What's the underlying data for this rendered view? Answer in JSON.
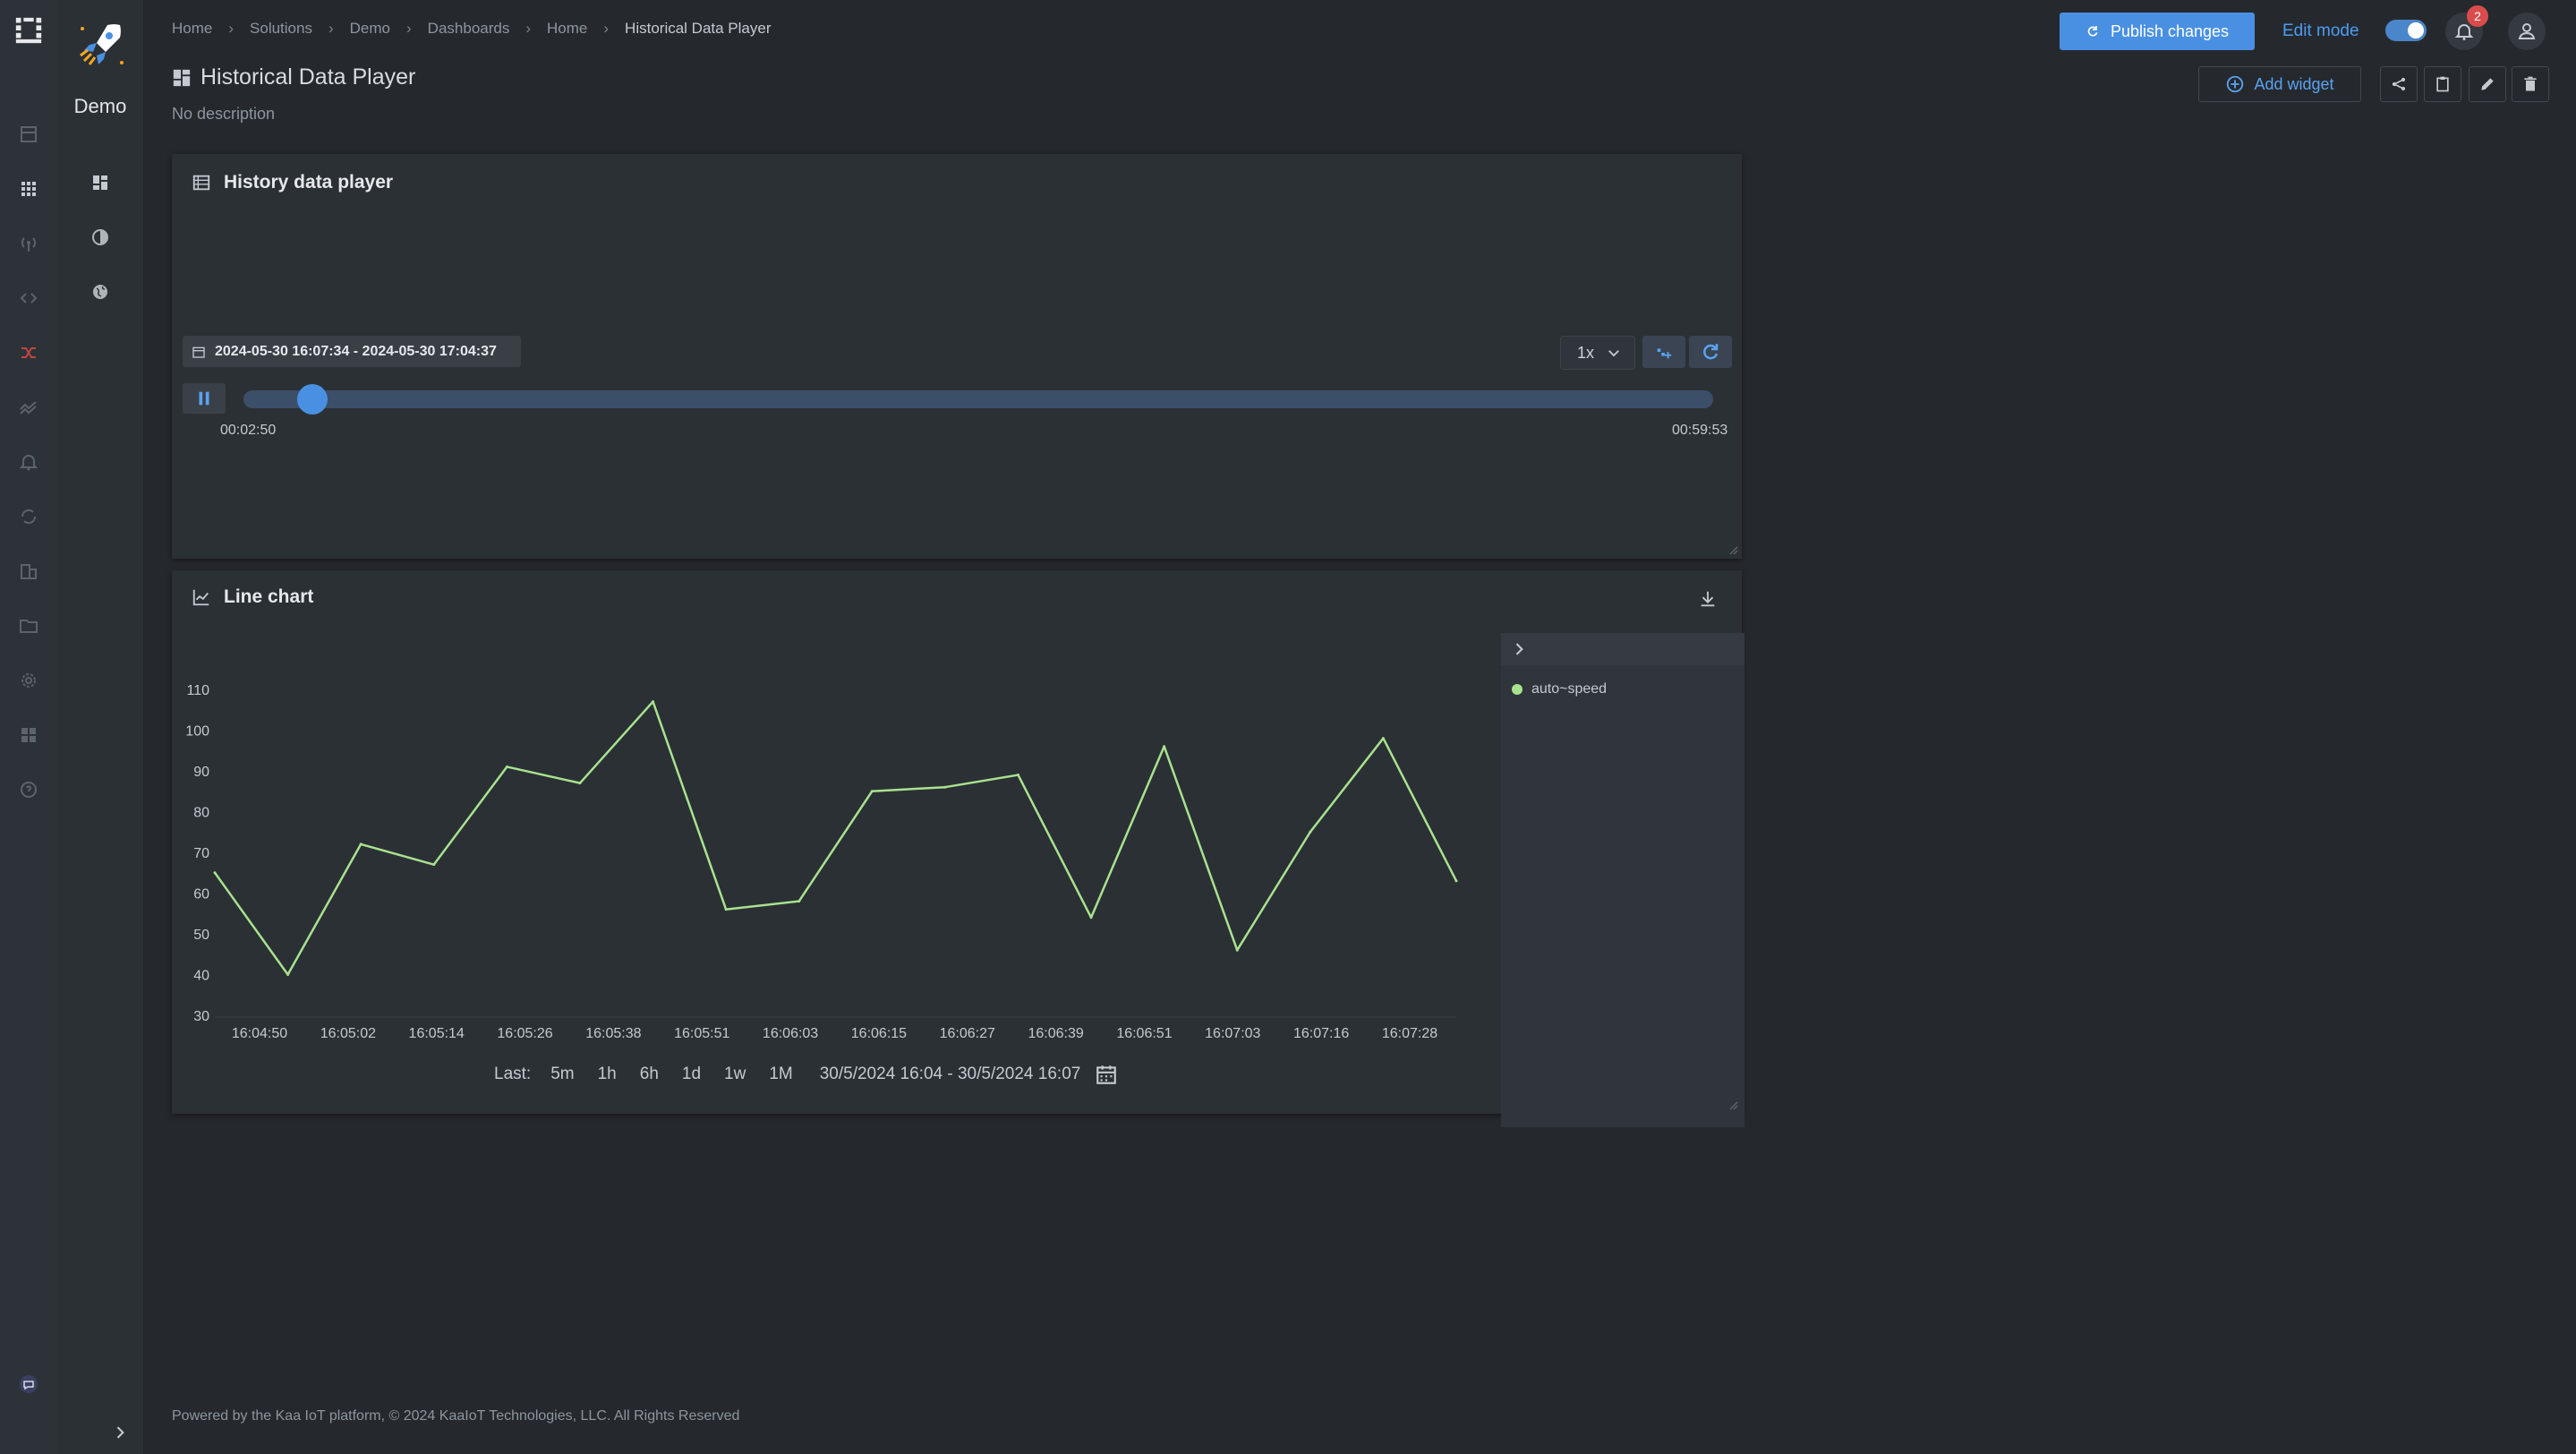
{
  "breadcrumbs": [
    "Home",
    "Solutions",
    "Demo",
    "Dashboards",
    "Home",
    "Historical Data Player"
  ],
  "app": {
    "title": "Demo"
  },
  "page": {
    "title": "Historical Data Player",
    "description": "No description"
  },
  "header": {
    "publish_label": "Publish changes",
    "edit_mode_label": "Edit mode",
    "notifications_count": "2",
    "accent_color": "#4a90e2",
    "badge_color": "#d94c4c"
  },
  "toolbar": {
    "add_widget_label": "Add widget"
  },
  "player": {
    "title": "History data player",
    "range": "2024-05-30 16:07:34 - 2024-05-30 17:04:37",
    "speed": "1x",
    "elapsed": "00:02:50",
    "total": "00:59:53",
    "progress_fraction": 0.047
  },
  "line_chart": {
    "title": "Line chart",
    "range_label": "Last:",
    "range_options": [
      "5m",
      "1h",
      "6h",
      "1d",
      "1w",
      "1M"
    ],
    "date_range": "30/5/2024 16:04 - 30/5/2024 16:07"
  },
  "chart_data": {
    "type": "line",
    "x_ticks": [
      "16:04:50",
      "16:05:02",
      "16:05:14",
      "16:05:26",
      "16:05:38",
      "16:05:51",
      "16:06:03",
      "16:06:15",
      "16:06:27",
      "16:06:39",
      "16:06:51",
      "16:07:03",
      "16:07:16",
      "16:07:28"
    ],
    "y_ticks": [
      30,
      40,
      50,
      60,
      70,
      80,
      90,
      100,
      110
    ],
    "ylim": [
      30,
      110
    ],
    "grid": false,
    "legend_position": "right",
    "series": [
      {
        "name": "auto~speed",
        "color": "#a8e28e",
        "values": [
          65,
          40,
          72,
          67,
          91,
          87,
          107,
          56,
          58,
          85,
          86,
          89,
          54,
          96,
          46,
          75,
          98,
          63
        ]
      }
    ]
  },
  "footer": {
    "text": "Powered by the Kaa IoT platform, © 2024 KaaIoT Technologies, LLC. All Rights Reserved"
  }
}
